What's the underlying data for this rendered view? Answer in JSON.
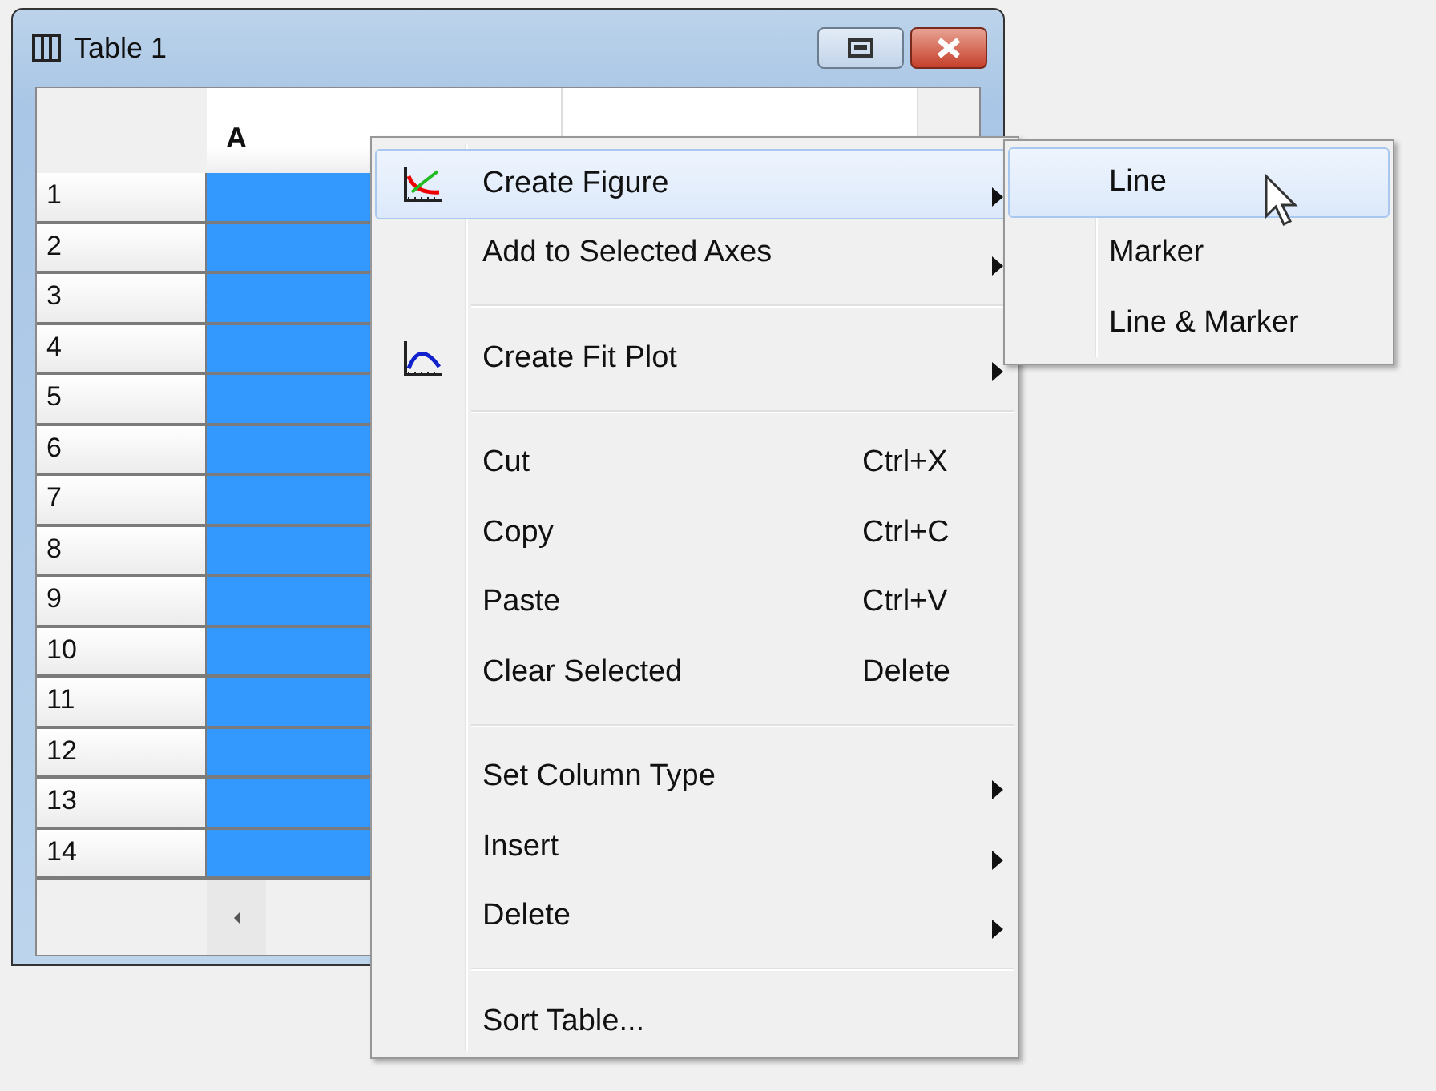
{
  "window": {
    "title": "Table 1"
  },
  "table": {
    "columns": [
      {
        "label": "A",
        "selected": true
      }
    ],
    "rows": [
      "1",
      "2",
      "3",
      "4",
      "5",
      "6",
      "7",
      "8",
      "9",
      "10",
      "11",
      "12",
      "13",
      "14"
    ]
  },
  "context_menu": {
    "items": [
      {
        "kind": "item",
        "label": "Create Figure",
        "submenu": true,
        "selected": true
      },
      {
        "kind": "item",
        "label": "Add to Selected Axes",
        "submenu": true,
        "selected": false
      },
      {
        "kind": "separator"
      },
      {
        "kind": "item",
        "label": "Create Fit Plot",
        "submenu": true,
        "selected": false
      },
      {
        "kind": "separator"
      },
      {
        "kind": "item",
        "label": "Cut",
        "shortcut": "Ctrl+X",
        "selected": false
      },
      {
        "kind": "item",
        "label": "Copy",
        "shortcut": "Ctrl+C",
        "selected": false
      },
      {
        "kind": "item",
        "label": "Paste",
        "shortcut": "Ctrl+V",
        "selected": false
      },
      {
        "kind": "item",
        "label": "Clear Selected",
        "shortcut": "Delete",
        "selected": false
      },
      {
        "kind": "separator"
      },
      {
        "kind": "item",
        "label": "Set Column Type",
        "submenu": true,
        "selected": false
      },
      {
        "kind": "item",
        "label": "Insert",
        "submenu": true,
        "selected": false
      },
      {
        "kind": "item",
        "label": "Delete",
        "submenu": true,
        "selected": false
      },
      {
        "kind": "separator"
      },
      {
        "kind": "item",
        "label": "Sort Table...",
        "selected": false
      }
    ]
  },
  "submenu": {
    "items": [
      {
        "label": "Line",
        "selected": true
      },
      {
        "label": "Marker",
        "selected": false
      },
      {
        "label": "Line & Marker",
        "selected": false
      }
    ]
  }
}
